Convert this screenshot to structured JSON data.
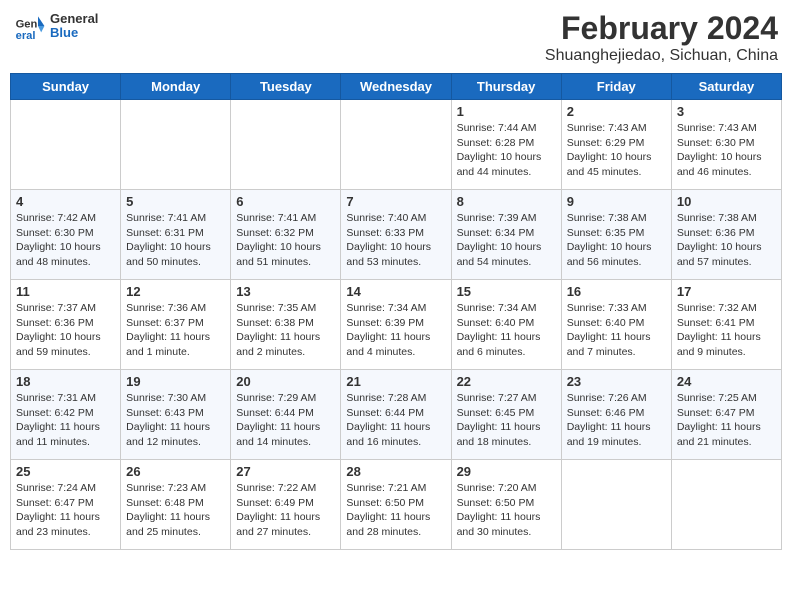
{
  "header": {
    "logo": {
      "general": "General",
      "blue": "Blue"
    },
    "title": "February 2024",
    "location": "Shuanghejiedao, Sichuan, China"
  },
  "days_of_week": [
    "Sunday",
    "Monday",
    "Tuesday",
    "Wednesday",
    "Thursday",
    "Friday",
    "Saturday"
  ],
  "weeks": [
    [
      {
        "day": "",
        "info": ""
      },
      {
        "day": "",
        "info": ""
      },
      {
        "day": "",
        "info": ""
      },
      {
        "day": "",
        "info": ""
      },
      {
        "day": "1",
        "info": "Sunrise: 7:44 AM\nSunset: 6:28 PM\nDaylight: 10 hours\nand 44 minutes."
      },
      {
        "day": "2",
        "info": "Sunrise: 7:43 AM\nSunset: 6:29 PM\nDaylight: 10 hours\nand 45 minutes."
      },
      {
        "day": "3",
        "info": "Sunrise: 7:43 AM\nSunset: 6:30 PM\nDaylight: 10 hours\nand 46 minutes."
      }
    ],
    [
      {
        "day": "4",
        "info": "Sunrise: 7:42 AM\nSunset: 6:30 PM\nDaylight: 10 hours\nand 48 minutes."
      },
      {
        "day": "5",
        "info": "Sunrise: 7:41 AM\nSunset: 6:31 PM\nDaylight: 10 hours\nand 50 minutes."
      },
      {
        "day": "6",
        "info": "Sunrise: 7:41 AM\nSunset: 6:32 PM\nDaylight: 10 hours\nand 51 minutes."
      },
      {
        "day": "7",
        "info": "Sunrise: 7:40 AM\nSunset: 6:33 PM\nDaylight: 10 hours\nand 53 minutes."
      },
      {
        "day": "8",
        "info": "Sunrise: 7:39 AM\nSunset: 6:34 PM\nDaylight: 10 hours\nand 54 minutes."
      },
      {
        "day": "9",
        "info": "Sunrise: 7:38 AM\nSunset: 6:35 PM\nDaylight: 10 hours\nand 56 minutes."
      },
      {
        "day": "10",
        "info": "Sunrise: 7:38 AM\nSunset: 6:36 PM\nDaylight: 10 hours\nand 57 minutes."
      }
    ],
    [
      {
        "day": "11",
        "info": "Sunrise: 7:37 AM\nSunset: 6:36 PM\nDaylight: 10 hours\nand 59 minutes."
      },
      {
        "day": "12",
        "info": "Sunrise: 7:36 AM\nSunset: 6:37 PM\nDaylight: 11 hours\nand 1 minute."
      },
      {
        "day": "13",
        "info": "Sunrise: 7:35 AM\nSunset: 6:38 PM\nDaylight: 11 hours\nand 2 minutes."
      },
      {
        "day": "14",
        "info": "Sunrise: 7:34 AM\nSunset: 6:39 PM\nDaylight: 11 hours\nand 4 minutes."
      },
      {
        "day": "15",
        "info": "Sunrise: 7:34 AM\nSunset: 6:40 PM\nDaylight: 11 hours\nand 6 minutes."
      },
      {
        "day": "16",
        "info": "Sunrise: 7:33 AM\nSunset: 6:40 PM\nDaylight: 11 hours\nand 7 minutes."
      },
      {
        "day": "17",
        "info": "Sunrise: 7:32 AM\nSunset: 6:41 PM\nDaylight: 11 hours\nand 9 minutes."
      }
    ],
    [
      {
        "day": "18",
        "info": "Sunrise: 7:31 AM\nSunset: 6:42 PM\nDaylight: 11 hours\nand 11 minutes."
      },
      {
        "day": "19",
        "info": "Sunrise: 7:30 AM\nSunset: 6:43 PM\nDaylight: 11 hours\nand 12 minutes."
      },
      {
        "day": "20",
        "info": "Sunrise: 7:29 AM\nSunset: 6:44 PM\nDaylight: 11 hours\nand 14 minutes."
      },
      {
        "day": "21",
        "info": "Sunrise: 7:28 AM\nSunset: 6:44 PM\nDaylight: 11 hours\nand 16 minutes."
      },
      {
        "day": "22",
        "info": "Sunrise: 7:27 AM\nSunset: 6:45 PM\nDaylight: 11 hours\nand 18 minutes."
      },
      {
        "day": "23",
        "info": "Sunrise: 7:26 AM\nSunset: 6:46 PM\nDaylight: 11 hours\nand 19 minutes."
      },
      {
        "day": "24",
        "info": "Sunrise: 7:25 AM\nSunset: 6:47 PM\nDaylight: 11 hours\nand 21 minutes."
      }
    ],
    [
      {
        "day": "25",
        "info": "Sunrise: 7:24 AM\nSunset: 6:47 PM\nDaylight: 11 hours\nand 23 minutes."
      },
      {
        "day": "26",
        "info": "Sunrise: 7:23 AM\nSunset: 6:48 PM\nDaylight: 11 hours\nand 25 minutes."
      },
      {
        "day": "27",
        "info": "Sunrise: 7:22 AM\nSunset: 6:49 PM\nDaylight: 11 hours\nand 27 minutes."
      },
      {
        "day": "28",
        "info": "Sunrise: 7:21 AM\nSunset: 6:50 PM\nDaylight: 11 hours\nand 28 minutes."
      },
      {
        "day": "29",
        "info": "Sunrise: 7:20 AM\nSunset: 6:50 PM\nDaylight: 11 hours\nand 30 minutes."
      },
      {
        "day": "",
        "info": ""
      },
      {
        "day": "",
        "info": ""
      }
    ]
  ]
}
